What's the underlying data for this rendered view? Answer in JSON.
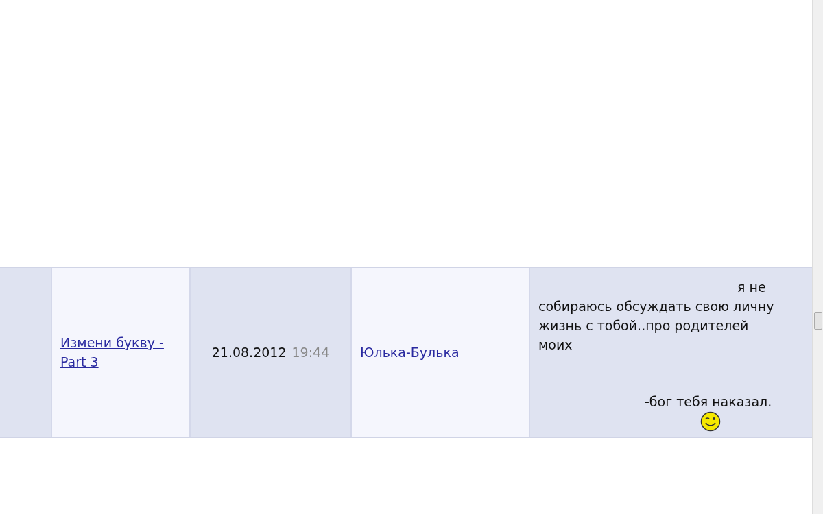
{
  "table": {
    "rows": [
      {
        "topic": "Измени букву - Part 3",
        "date": "21.08.2012",
        "time": "19:44",
        "author": "Юлька-Булька",
        "message": [
          "я не",
          "собираюсь обсуждать свою личну",
          "жизнь с тобой..про родителей",
          "моих",
          "-бог тебя наказал."
        ]
      }
    ]
  }
}
